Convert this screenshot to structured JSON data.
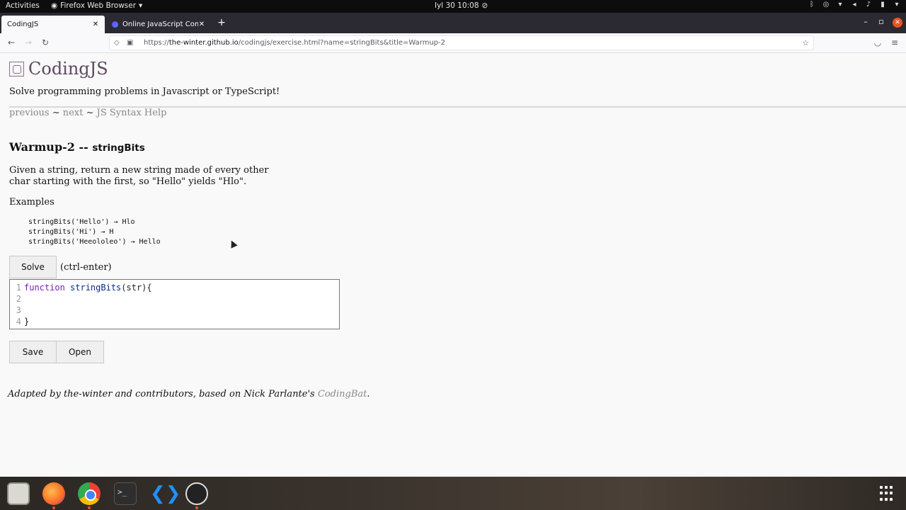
{
  "system_bar": {
    "activities": "Activities",
    "app_menu": "Firefox Web Browser",
    "clock": "Iyl 30  10:08"
  },
  "browser": {
    "tabs": [
      {
        "label": "CodingJS",
        "active": true
      },
      {
        "label": "Online JavaScript Compil",
        "active": false
      }
    ],
    "url_host": "the-winter.github.io",
    "url_prefix": "https://",
    "url_path": "/codingjs/exercise.html?name=stringBits&title=Warmup-2"
  },
  "page": {
    "site_title": "CodingJS",
    "tagline": "Solve programming problems in Javascript or TypeScript!",
    "nav": {
      "previous": "previous",
      "next": "next",
      "help": "JS Syntax Help",
      "sep": "~"
    },
    "exercise": {
      "category": "Warmup-2 --",
      "name": "stringBits",
      "description": "Given a string, return a new string made of every other char starting with the first, so \"Hello\" yields \"Hlo\".",
      "examples_label": "Examples",
      "examples": [
        "stringBits('Hello') → Hlo",
        "stringBits('Hi') → H",
        "stringBits('Heeololeo') → Hello"
      ]
    },
    "solve_label": "Solve",
    "solve_hint": "(ctrl-enter)",
    "editor": {
      "lines": [
        {
          "num": "1",
          "kw": "function",
          "fn": "stringBits",
          "rest": "(str){"
        },
        {
          "num": "2",
          "kw": "",
          "fn": "",
          "rest": ""
        },
        {
          "num": "3",
          "kw": "",
          "fn": "",
          "rest": ""
        },
        {
          "num": "4",
          "kw": "",
          "fn": "",
          "rest": "}"
        }
      ]
    },
    "save_label": "Save",
    "open_label": "Open",
    "footer": {
      "text": "Adapted by the-winter and contributors, based on Nick Parlante's",
      "link": "CodingBat",
      "end": "."
    }
  },
  "dock": {
    "items": [
      "files-icon",
      "firefox-icon",
      "chrome-icon",
      "terminal-icon",
      "vscode-icon",
      "obs-icon"
    ]
  },
  "colors": {
    "accent": "#e95420",
    "title": "#5e4960",
    "link": "#888888"
  }
}
